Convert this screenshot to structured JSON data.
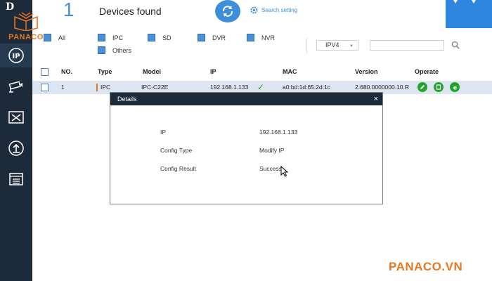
{
  "watermark": {
    "logo_text": "PANACO",
    "footer_text": "PANACO.VN"
  },
  "sidebar": {
    "logo_text": "D",
    "items": [
      {
        "icon": "ip-icon",
        "active": true
      },
      {
        "icon": "camera-icon"
      },
      {
        "icon": "tools-icon"
      },
      {
        "icon": "upgrade-icon"
      },
      {
        "icon": "list-icon"
      }
    ]
  },
  "header": {
    "count": "1",
    "title": "Devices found",
    "search_setting_label": "Search setting"
  },
  "filters": {
    "all": "All",
    "ipc": "IPC",
    "sd": "SD",
    "dvr": "DVR",
    "nvr": "NVR",
    "others": "Others",
    "ip_version": "IPV4",
    "search_value": ""
  },
  "table": {
    "columns": [
      "NO.",
      "Type",
      "Model",
      "IP",
      "MAC",
      "Version",
      "Operate"
    ],
    "rows": [
      {
        "no": "1",
        "type": "IPC",
        "model": "IPC-C22E",
        "ip": "192.168.1.133",
        "mac": "a0:bd:1d:65:2d:1c",
        "version": "2.680.0000000.10.R"
      }
    ]
  },
  "dialog": {
    "title": "Details",
    "close": "×",
    "fields": [
      {
        "label": "IP",
        "value": "192.168.1.133"
      },
      {
        "label": "Config Type",
        "value": "Modify IP"
      },
      {
        "label": "Config Result",
        "value": "Success"
      }
    ]
  },
  "colors": {
    "sidebar": "#1c2a3a",
    "accent": "#3d8fd9",
    "brand": "#e87722",
    "success": "#22a32c"
  }
}
